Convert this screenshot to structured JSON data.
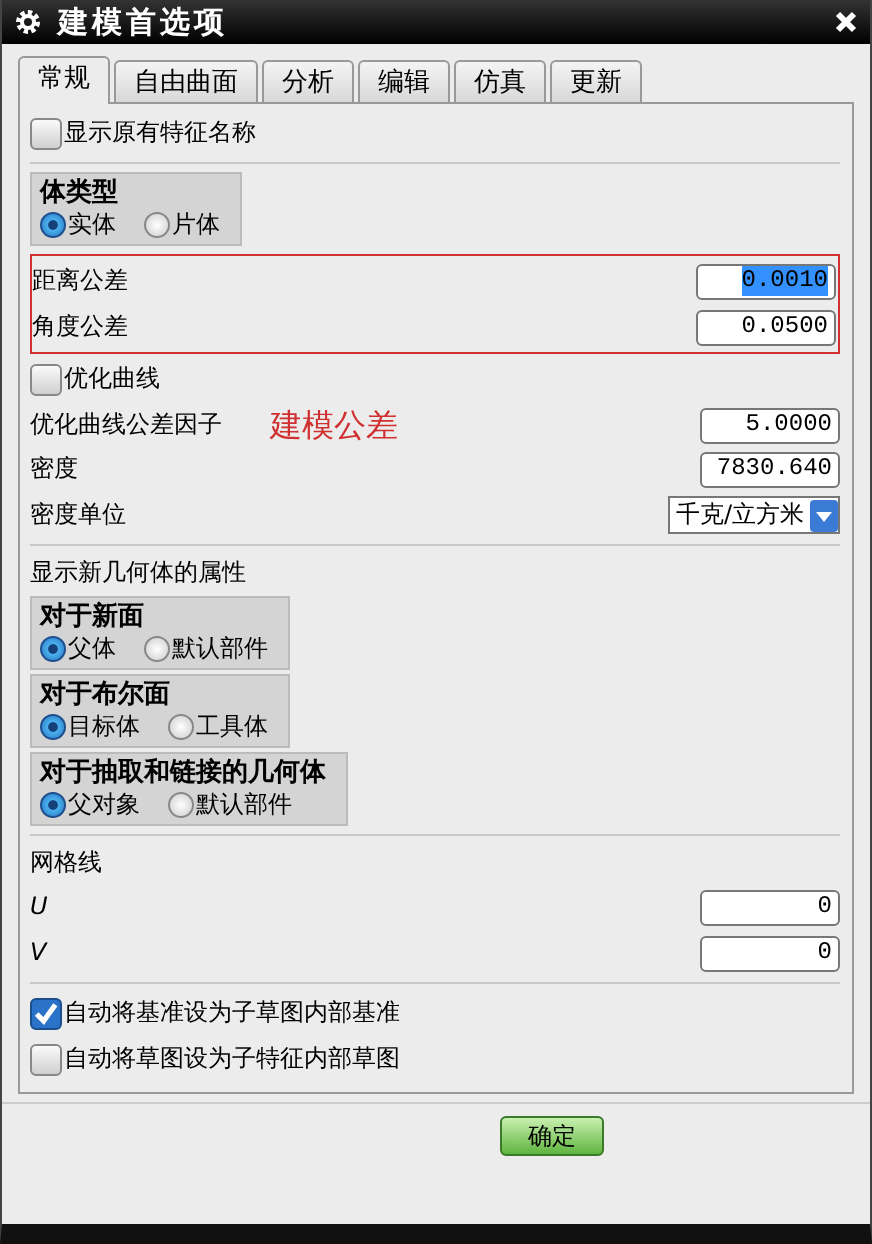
{
  "window": {
    "title": "建模首选项"
  },
  "tabs": [
    {
      "label": "常规",
      "selected": true
    },
    {
      "label": "自由曲面",
      "selected": false
    },
    {
      "label": "分析",
      "selected": false
    },
    {
      "label": "编辑",
      "selected": false
    },
    {
      "label": "仿真",
      "selected": false
    },
    {
      "label": "更新",
      "selected": false
    }
  ],
  "show_original_feature_names": {
    "label": "显示原有特征名称",
    "checked": false
  },
  "body_type": {
    "title": "体类型",
    "options": [
      {
        "label": "实体",
        "selected": true
      },
      {
        "label": "片体",
        "selected": false
      }
    ]
  },
  "tolerances": [
    {
      "label": "距离公差",
      "value": "0.0010",
      "selected": true
    },
    {
      "label": "角度公差",
      "value": "0.0500",
      "selected": false
    }
  ],
  "annotation": {
    "text": "建模公差"
  },
  "optimize_curves": {
    "label": "优化曲线",
    "checked": false
  },
  "fields": [
    {
      "label": "优化曲线公差因子",
      "value": "5.0000"
    },
    {
      "label": "密度",
      "value": "7830.640"
    }
  ],
  "density_unit": {
    "label": "密度单位",
    "value": "千克/立方米"
  },
  "new_geometry": {
    "title": "显示新几何体的属性",
    "groups": [
      {
        "title": "对于新面",
        "options": [
          {
            "label": "父体",
            "selected": true
          },
          {
            "label": "默认部件",
            "selected": false
          }
        ]
      },
      {
        "title": "对于布尔面",
        "options": [
          {
            "label": "目标体",
            "selected": true
          },
          {
            "label": "工具体",
            "selected": false
          }
        ]
      },
      {
        "title": "对于抽取和链接的几何体",
        "options": [
          {
            "label": "父对象",
            "selected": true
          },
          {
            "label": "默认部件",
            "selected": false
          }
        ]
      }
    ]
  },
  "grid_lines": {
    "title": "网格线",
    "fields": [
      {
        "label": "U",
        "value": "0"
      },
      {
        "label": "V",
        "value": "0"
      }
    ]
  },
  "options": [
    {
      "label": "自动将基准设为子草图内部基准",
      "checked": true
    },
    {
      "label": "自动将草图设为子特征内部草图",
      "checked": false
    }
  ],
  "buttons": [
    "确定"
  ]
}
